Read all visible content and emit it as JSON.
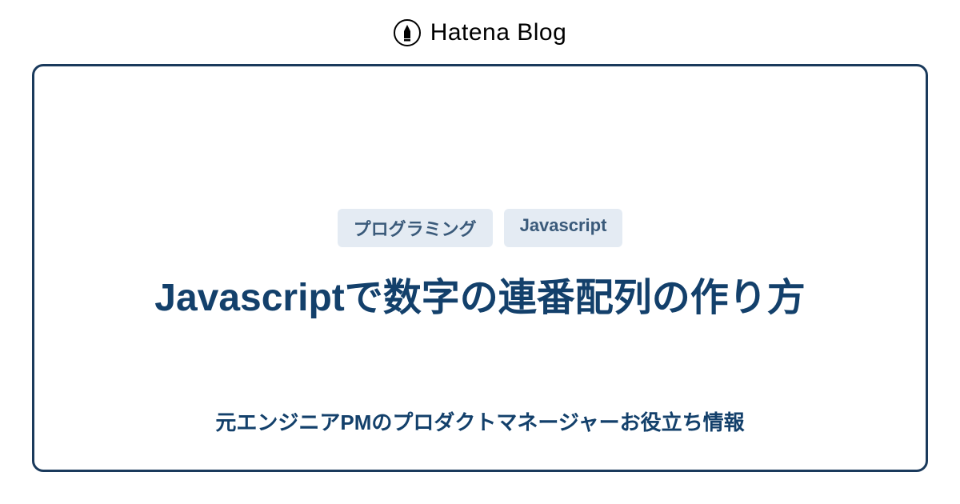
{
  "header": {
    "brand": "Hatena Blog"
  },
  "card": {
    "tags": [
      "プログラミング",
      "Javascript"
    ],
    "title": "Javascriptで数字の連番配列の作り方",
    "subtitle": "元エンジニアPMのプロダクトマネージャーお役立ち情報"
  }
}
